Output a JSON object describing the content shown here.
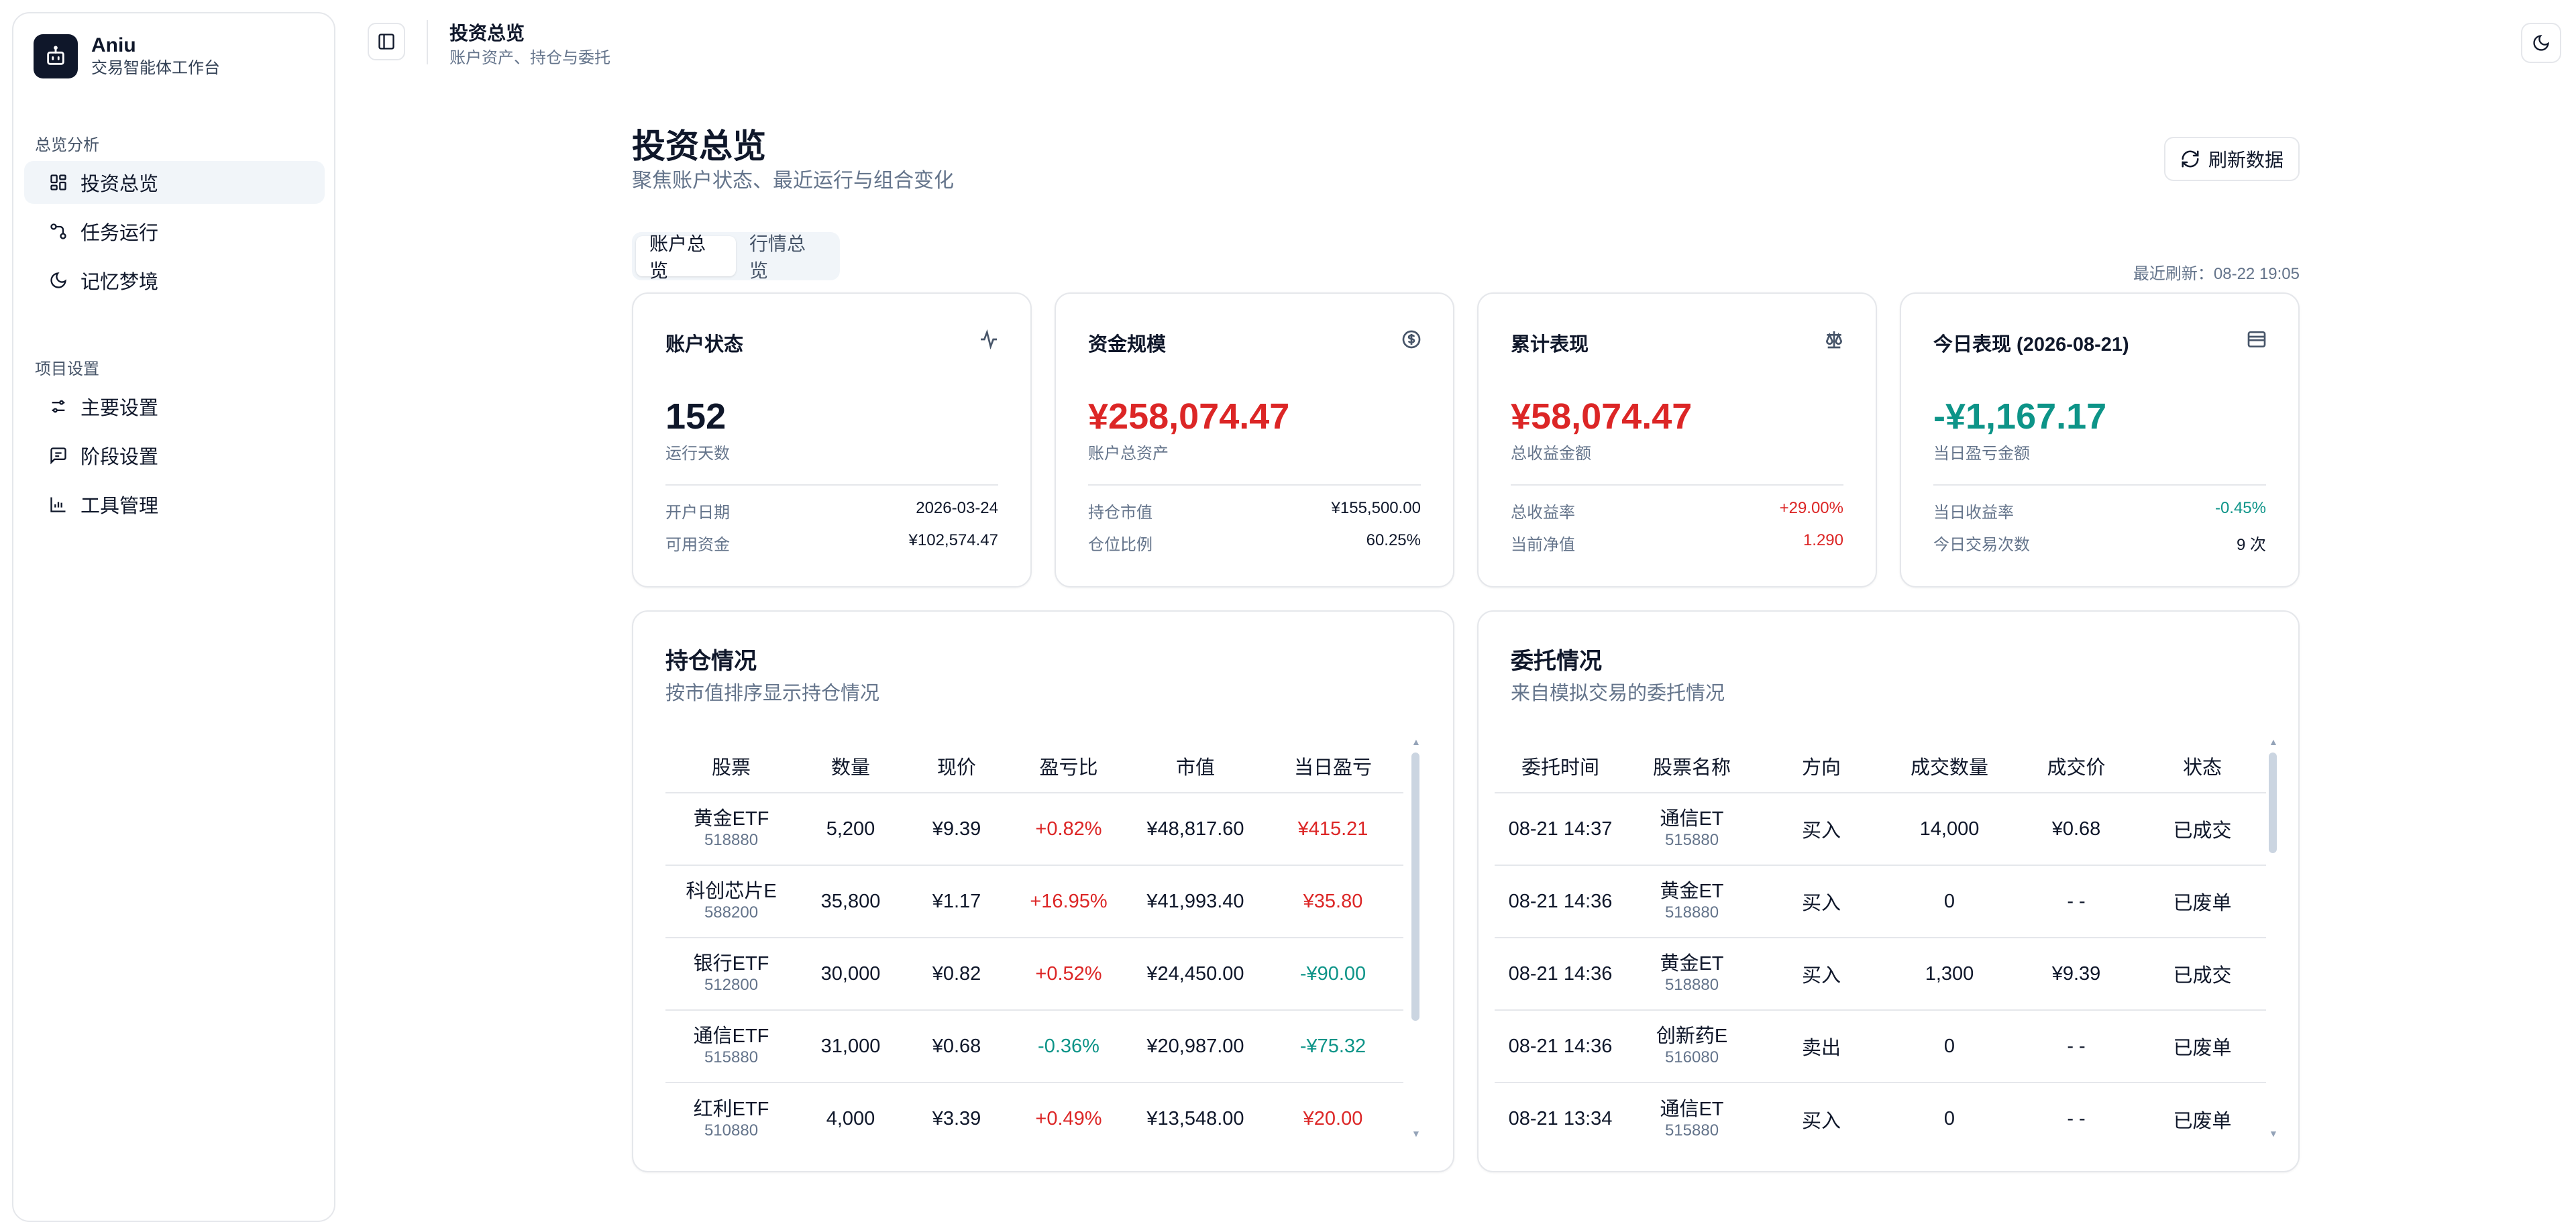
{
  "app": {
    "name": "Aniu",
    "subtitle": "交易智能体工作台"
  },
  "sidebar": {
    "group1": "总览分析",
    "group2": "项目设置",
    "items": [
      {
        "label": "投资总览",
        "icon": "dashboard-icon",
        "active": true
      },
      {
        "label": "任务运行",
        "icon": "workflow-icon"
      },
      {
        "label": "记忆梦境",
        "icon": "moon-icon"
      },
      {
        "label": "主要设置",
        "icon": "sliders-icon"
      },
      {
        "label": "阶段设置",
        "icon": "message-square-icon"
      },
      {
        "label": "工具管理",
        "icon": "chart-icon"
      }
    ]
  },
  "topbar": {
    "title": "投资总览",
    "subtitle": "账户资产、持仓与委托"
  },
  "header": {
    "title": "投资总览",
    "subtitle": "聚焦账户状态、最近运行与组合变化",
    "refresh_label": "刷新数据",
    "last_refresh": "最近刷新：08-22 19:05"
  },
  "tabs": [
    "账户总览",
    "行情总览"
  ],
  "stats": [
    {
      "title": "账户状态",
      "icon": "activity-icon",
      "value": "152",
      "label": "运行天数",
      "rows": [
        {
          "k": "开户日期",
          "v": "2026-03-24"
        },
        {
          "k": "可用资金",
          "v": "¥102,574.47"
        }
      ]
    },
    {
      "title": "资金规模",
      "icon": "dollar-circle-icon",
      "value": "¥258,074.47",
      "label": "账户总资产",
      "rows": [
        {
          "k": "持仓市值",
          "v": "¥155,500.00"
        },
        {
          "k": "仓位比例",
          "v": "60.25%"
        }
      ]
    },
    {
      "title": "累计表现",
      "icon": "scale-icon",
      "value": "¥58,074.47",
      "label": "总收益金额",
      "rows": [
        {
          "k": "总收益率",
          "v": "+29.00%"
        },
        {
          "k": "当前净值",
          "v": "1.290"
        }
      ]
    },
    {
      "title": "今日表现 (2026-08-21)",
      "icon": "wallet-icon",
      "value": "-¥1,167.17",
      "label": "当日盈亏金额",
      "rows": [
        {
          "k": "当日收益率",
          "v": "-0.45%"
        },
        {
          "k": "今日交易次数",
          "v": "9 次"
        }
      ]
    }
  ],
  "holdings": {
    "title": "持仓情况",
    "subtitle": "按市值排序显示持仓情况",
    "columns": [
      "股票",
      "数量",
      "现价",
      "盈亏比",
      "市值",
      "当日盈亏"
    ],
    "rows": [
      {
        "name": "黄金ETF",
        "code": "518880",
        "qty": "5,200",
        "price": "¥9.39",
        "pnl_pct": "+0.82%",
        "mv": "¥48,817.60",
        "day": "¥415.21"
      },
      {
        "name": "科创芯片E",
        "code": "588200",
        "qty": "35,800",
        "price": "¥1.17",
        "pnl_pct": "+16.95%",
        "mv": "¥41,993.40",
        "day": "¥35.80"
      },
      {
        "name": "银行ETF",
        "code": "512800",
        "qty": "30,000",
        "price": "¥0.82",
        "pnl_pct": "+0.52%",
        "mv": "¥24,450.00",
        "day": "-¥90.00"
      },
      {
        "name": "通信ETF",
        "code": "515880",
        "qty": "31,000",
        "price": "¥0.68",
        "pnl_pct": "-0.36%",
        "mv": "¥20,987.00",
        "day": "-¥75.32"
      },
      {
        "name": "红利ETF",
        "code": "510880",
        "qty": "4,000",
        "price": "¥3.39",
        "pnl_pct": "+0.49%",
        "mv": "¥13,548.00",
        "day": "¥20.00"
      }
    ]
  },
  "orders": {
    "title": "委托情况",
    "subtitle": "来自模拟交易的委托情况",
    "columns": [
      "委托时间",
      "股票名称",
      "方向",
      "成交数量",
      "成交价",
      "状态"
    ],
    "rows": [
      {
        "time": "08-21 14:37",
        "name": "通信ET",
        "code": "515880",
        "side": "买入",
        "qty": "14,000",
        "price": "¥0.68",
        "status": "已成交"
      },
      {
        "time": "08-21 14:36",
        "name": "黄金ET",
        "code": "518880",
        "side": "买入",
        "qty": "0",
        "price": "- -",
        "status": "已废单"
      },
      {
        "time": "08-21 14:36",
        "name": "黄金ET",
        "code": "518880",
        "side": "买入",
        "qty": "1,300",
        "price": "¥9.39",
        "status": "已成交"
      },
      {
        "time": "08-21 14:36",
        "name": "创新药E",
        "code": "516080",
        "side": "卖出",
        "qty": "0",
        "price": "- -",
        "status": "已废单"
      },
      {
        "time": "08-21 13:34",
        "name": "通信ET",
        "code": "515880",
        "side": "买入",
        "qty": "0",
        "price": "- -",
        "status": "已废单"
      }
    ]
  },
  "colors": {
    "positive": "#dc2626",
    "negative": "#0d9488",
    "muted": "#64748b",
    "border": "#e5e7eb"
  }
}
